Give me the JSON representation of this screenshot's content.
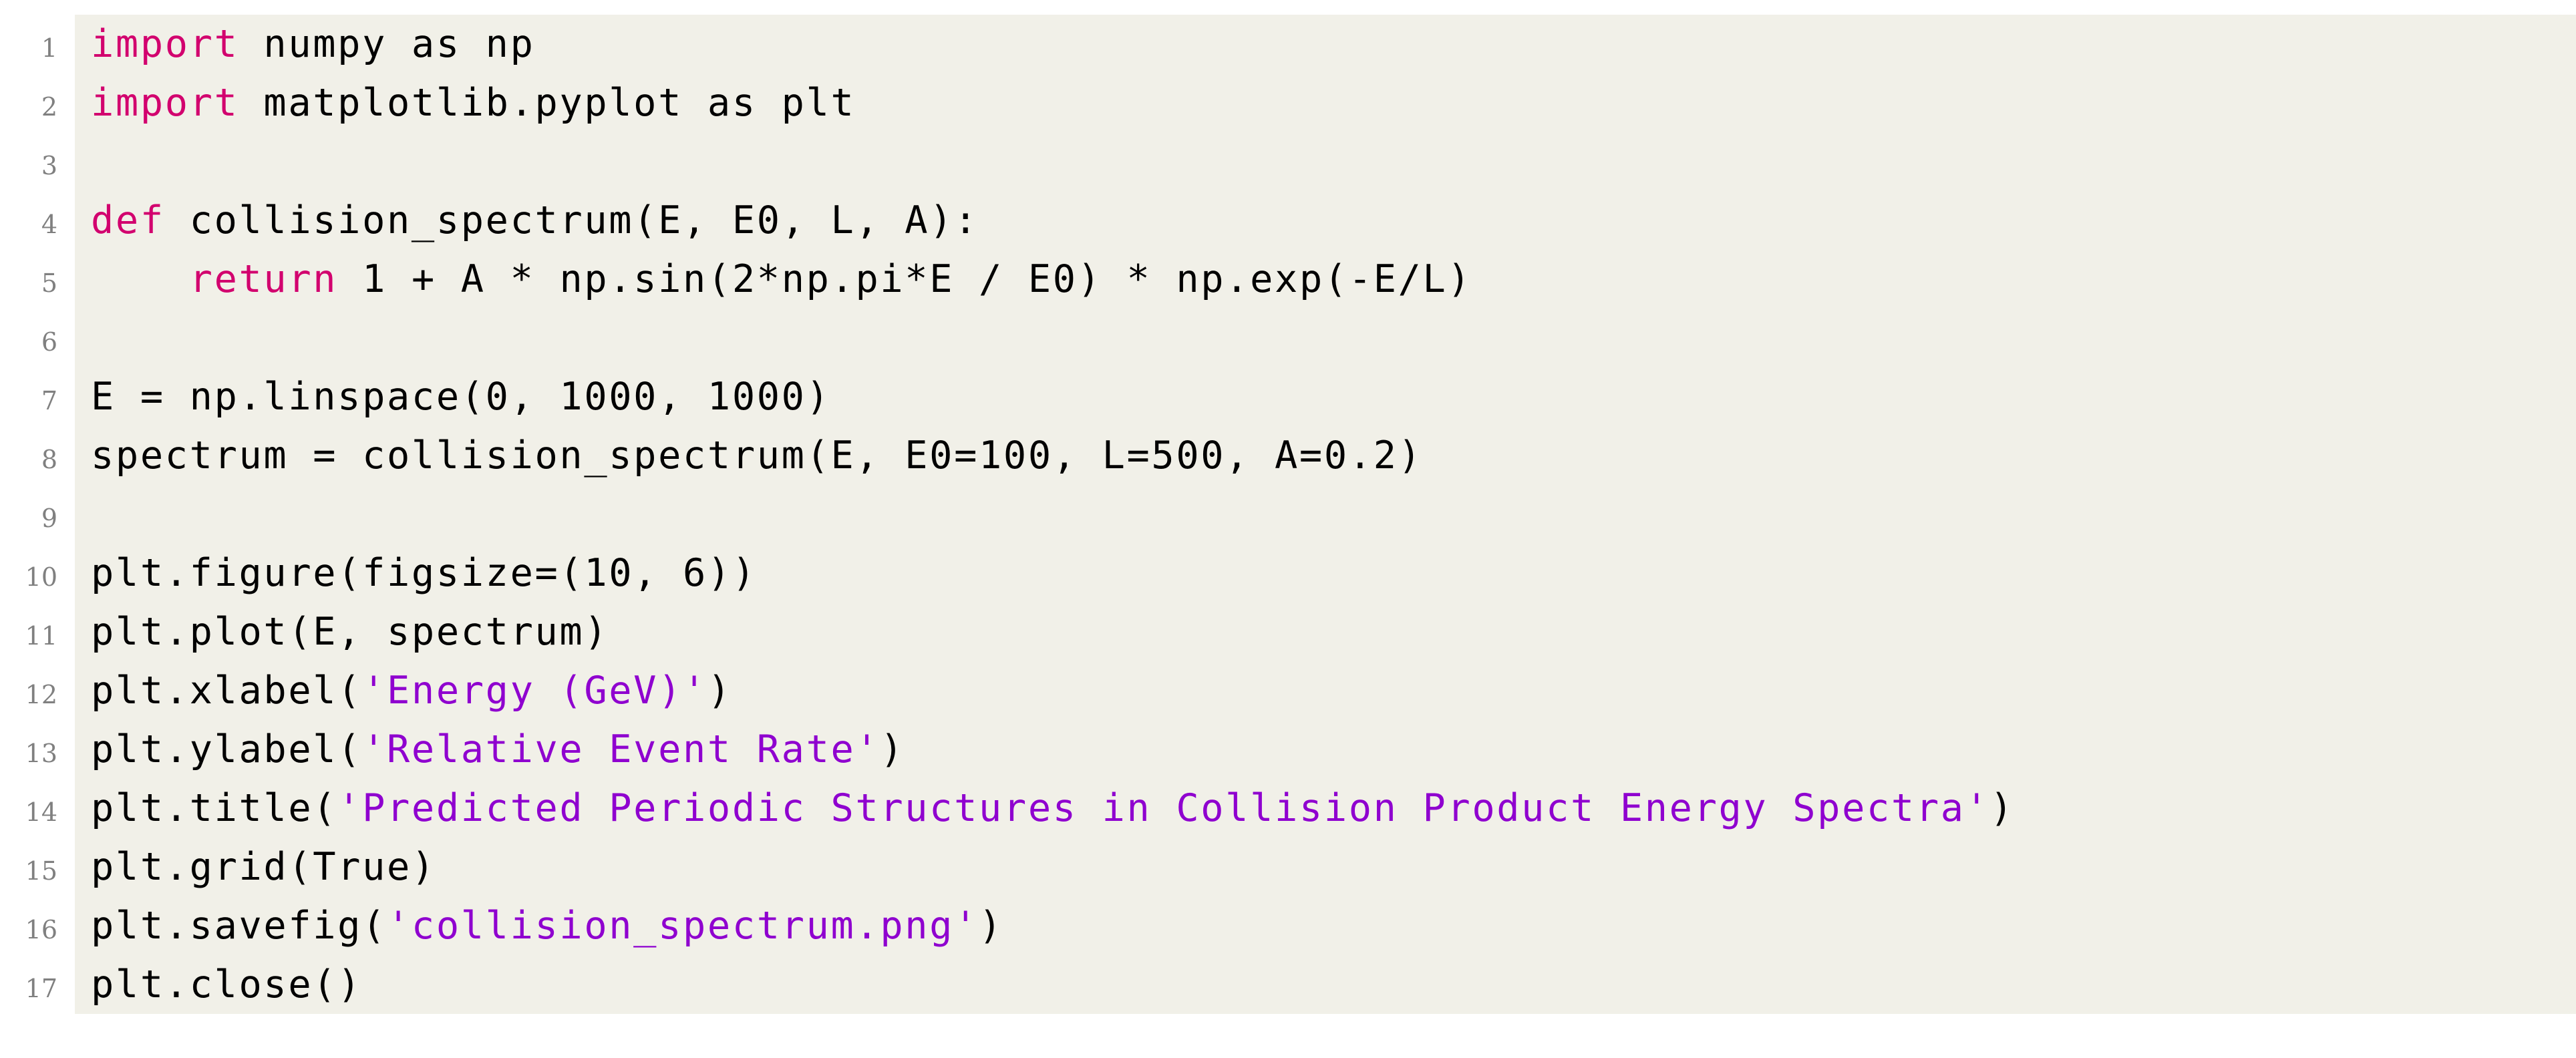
{
  "document": {
    "kind": "code-listing",
    "language": "Python",
    "background_color": "#ffffff",
    "code_background_color": "#f1f0e8",
    "linenumber_color": "#808080",
    "keyword_color": "#d2006e",
    "string_color": "#8f00cf",
    "plain_color": "#000000"
  },
  "listing": {
    "lines": [
      {
        "number": "1",
        "text": "import numpy as np",
        "tokens": [
          {
            "t": "import",
            "c": "kw"
          },
          {
            "t": " numpy as np",
            "c": "pl"
          }
        ]
      },
      {
        "number": "2",
        "text": "import matplotlib.pyplot as plt",
        "tokens": [
          {
            "t": "import",
            "c": "kw"
          },
          {
            "t": " matplotlib.pyplot as plt",
            "c": "pl"
          }
        ]
      },
      {
        "number": "3",
        "text": "",
        "tokens": []
      },
      {
        "number": "4",
        "text": "def collision_spectrum(E, E0, L, A):",
        "tokens": [
          {
            "t": "def",
            "c": "kw"
          },
          {
            "t": " collision_spectrum(E, E0, L, A):",
            "c": "pl"
          }
        ]
      },
      {
        "number": "5",
        "text": "    return 1 + A * np.sin(2*np.pi*E / E0) * np.exp(-E/L)",
        "tokens": [
          {
            "t": "    ",
            "c": "pl"
          },
          {
            "t": "return",
            "c": "kw"
          },
          {
            "t": " 1 + A * np.sin(2*np.pi*E / E0) * np.exp(-E/L)",
            "c": "pl"
          }
        ]
      },
      {
        "number": "6",
        "text": "",
        "tokens": []
      },
      {
        "number": "7",
        "text": "E = np.linspace(0, 1000, 1000)",
        "tokens": [
          {
            "t": "E = np.linspace(0, 1000, 1000)",
            "c": "pl"
          }
        ]
      },
      {
        "number": "8",
        "text": "spectrum = collision_spectrum(E, E0=100, L=500, A=0.2)",
        "tokens": [
          {
            "t": "spectrum = collision_spectrum(E, E0=100, L=500, A=0.2)",
            "c": "pl"
          }
        ]
      },
      {
        "number": "9",
        "text": "",
        "tokens": []
      },
      {
        "number": "10",
        "text": "plt.figure(figsize=(10, 6))",
        "tokens": [
          {
            "t": "plt.figure(figsize=(10, 6))",
            "c": "pl"
          }
        ]
      },
      {
        "number": "11",
        "text": "plt.plot(E, spectrum)",
        "tokens": [
          {
            "t": "plt.plot(E, spectrum)",
            "c": "pl"
          }
        ]
      },
      {
        "number": "12",
        "text": "plt.xlabel('Energy (GeV)')",
        "tokens": [
          {
            "t": "plt.xlabel(",
            "c": "pl"
          },
          {
            "t": "'Energy (GeV)'",
            "c": "str"
          },
          {
            "t": ")",
            "c": "pl"
          }
        ]
      },
      {
        "number": "13",
        "text": "plt.ylabel('Relative Event Rate')",
        "tokens": [
          {
            "t": "plt.ylabel(",
            "c": "pl"
          },
          {
            "t": "'Relative Event Rate'",
            "c": "str"
          },
          {
            "t": ")",
            "c": "pl"
          }
        ]
      },
      {
        "number": "14",
        "text": "plt.title('Predicted Periodic Structures in Collision Product Energy Spectra')",
        "tokens": [
          {
            "t": "plt.title(",
            "c": "pl"
          },
          {
            "t": "'Predicted Periodic Structures in Collision Product Energy Spectra'",
            "c": "str"
          },
          {
            "t": ")",
            "c": "pl"
          }
        ]
      },
      {
        "number": "15",
        "text": "plt.grid(True)",
        "tokens": [
          {
            "t": "plt.grid(True)",
            "c": "pl"
          }
        ]
      },
      {
        "number": "16",
        "text": "plt.savefig('collision_spectrum.png')",
        "tokens": [
          {
            "t": "plt.savefig(",
            "c": "pl"
          },
          {
            "t": "'collision_spectrum.png'",
            "c": "str"
          },
          {
            "t": ")",
            "c": "pl"
          }
        ]
      },
      {
        "number": "17",
        "text": "plt.close()",
        "tokens": [
          {
            "t": "plt.close()",
            "c": "pl"
          }
        ]
      }
    ]
  }
}
